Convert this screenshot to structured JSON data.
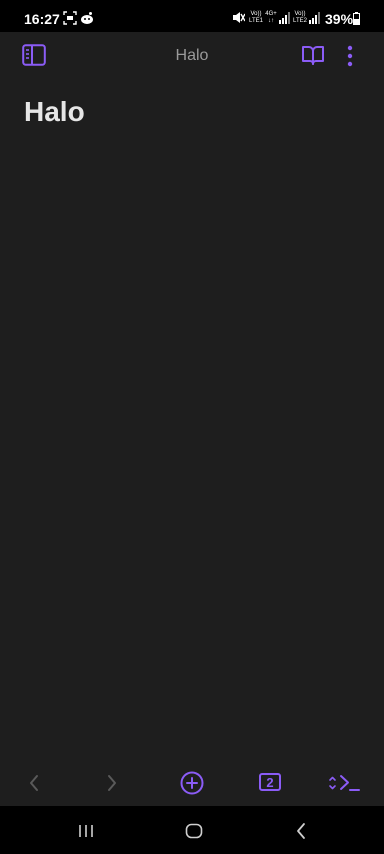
{
  "status_bar": {
    "time": "16:27",
    "net1_top": "Vo))",
    "net1_bottom": "LTE1",
    "net2_top": "4G+",
    "net2_bottom": "↓↑",
    "net3_top": "Vo))",
    "net3_bottom": "LTE2",
    "battery": "39%"
  },
  "header": {
    "title": "Halo",
    "sidebar_icon": "sidebar-toggle-icon",
    "reading_icon": "book-open-icon",
    "menu_icon": "more-vertical-icon"
  },
  "note": {
    "title": "Halo"
  },
  "bottom_toolbar": {
    "back_icon": "chevron-left-icon",
    "forward_icon": "chevron-right-icon",
    "new_note_icon": "plus-circle-icon",
    "tab_count": "2",
    "command_icon": "command-palette-icon"
  },
  "colors": {
    "accent": "#8b5cf6",
    "background": "#1e1e1e",
    "muted": "#5a5a5a"
  }
}
